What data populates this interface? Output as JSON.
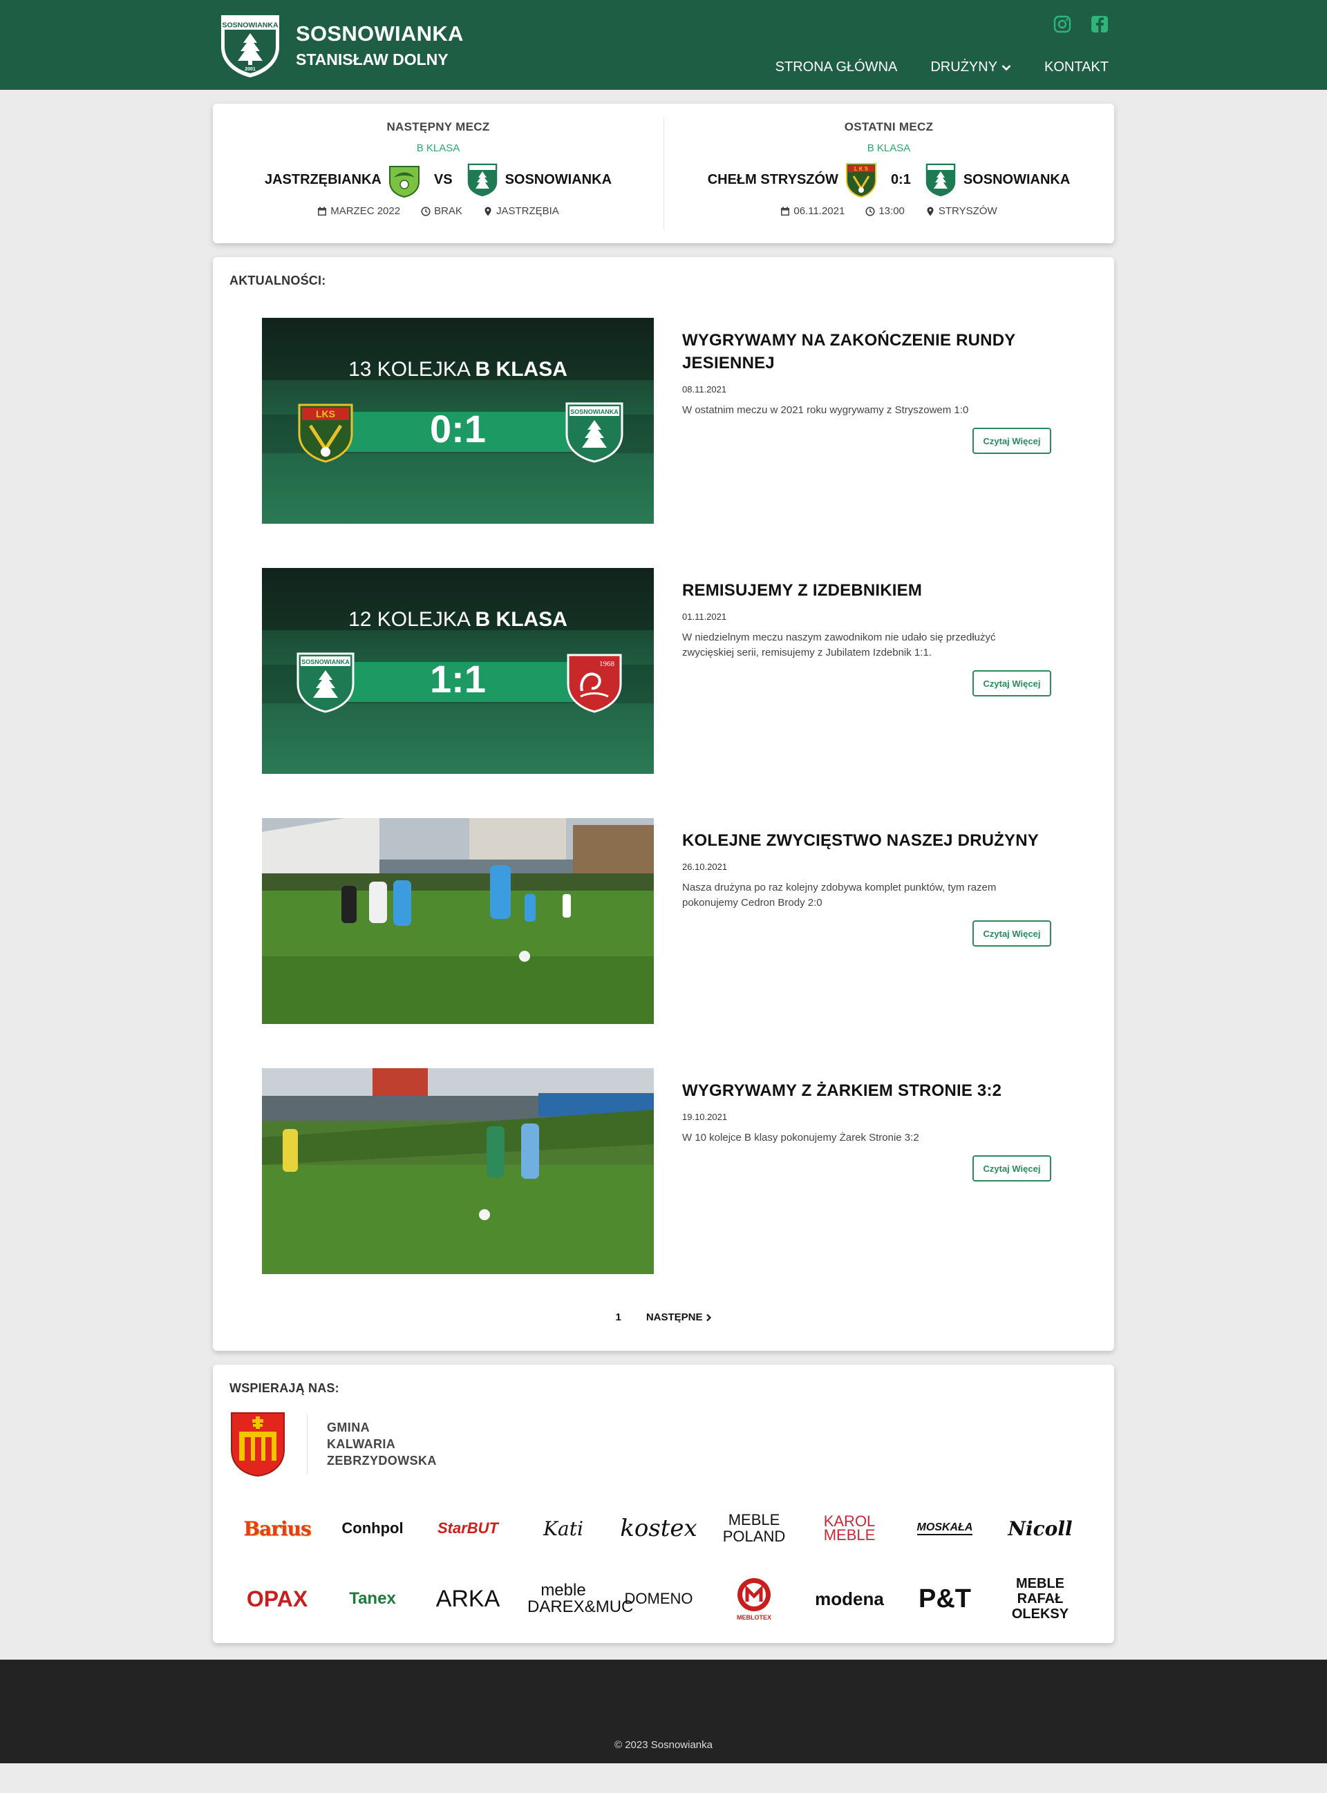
{
  "header": {
    "logo_text": "SOSNOWIANKA",
    "logo_year": "2001",
    "title": "SOSNOWIANKA",
    "subtitle": "STANISŁAW DOLNY",
    "social": [
      "instagram-icon",
      "facebook-icon"
    ],
    "nav": [
      {
        "label": "STRONA GŁÓWNA"
      },
      {
        "label": "DRUŻYNY"
      },
      {
        "label": "KONTAKT"
      }
    ],
    "colors": {
      "primary": "#1e5e44",
      "accent": "#2aa86a"
    }
  },
  "next_match": {
    "heading": "NASTĘPNY MECZ",
    "league": "B KLASA",
    "home": "JASTRZĘBIANKA",
    "separator": "VS",
    "away": "SOSNOWIANKA",
    "date": "MARZEC 2022",
    "time": "BRAK",
    "place": "JASTRZĘBIA"
  },
  "last_match": {
    "heading": "OSTATNI MECZ",
    "league": "B KLASA",
    "home": "CHEŁM STRYSZÓW",
    "score": "0:1",
    "away": "SOSNOWIANKA",
    "date": "06.11.2021",
    "time": "13:00",
    "place": "STRYSZÓW"
  },
  "news": {
    "heading": "AKTUALNOŚCI:",
    "read_more": "Czytaj Więcej",
    "items": [
      {
        "title": "WYGRYWAMY NA ZAKOŃCZENIE RUNDY JESIENNEJ",
        "date": "08.11.2021",
        "excerpt": "W ostatnim meczu w 2021 roku wygrywamy z Stryszowem 1:0",
        "graphic": {
          "round": "13 KOLEJKA",
          "league": "B KLASA",
          "score": "0:1",
          "left_crest": "LKS",
          "right_crest": "SOSNOWIANKA"
        }
      },
      {
        "title": "REMISUJEMY Z IZDEBNIKIEM",
        "date": "01.11.2021",
        "excerpt": "W niedzielnym meczu naszym zawodnikom nie udało się przedłużyć zwycięskiej serii, remisujemy z Jubilatem Izdebnik 1:1.",
        "graphic": {
          "round": "12 KOLEJKA",
          "league": "B KLASA",
          "score": "1:1",
          "left_crest": "SOSNOWIANKA",
          "right_crest": "1968"
        }
      },
      {
        "title": "KOLEJNE ZWYCIĘSTWO NASZEJ DRUŻYNY",
        "date": "26.10.2021",
        "excerpt": "Nasza drużyna po raz kolejny zdobywa komplet punktów, tym razem pokonujemy Cedron Brody 2:0"
      },
      {
        "title": "WYGRYWAMY Z ŻARKIEM STRONIE 3:2",
        "date": "19.10.2021",
        "excerpt": "W 10 kolejce B klasy pokonujemy Żarek Stronie 3:2"
      }
    ],
    "pagination": {
      "current": "1",
      "next": "NASTĘPNE"
    }
  },
  "sponsors": {
    "heading": "WSPIERAJĄ NAS:",
    "gmina": [
      "GMINA",
      "KALWARIA",
      "ZEBRZYDOWSKA"
    ],
    "logos": [
      {
        "text": "Barius",
        "color": "#e2401c"
      },
      {
        "text": "Conhpol",
        "color": "#111111"
      },
      {
        "text": "StarBUT",
        "color": "#d21c1c"
      },
      {
        "text": "Kati",
        "color": "#111111"
      },
      {
        "text": "kostex",
        "color": "#111111"
      },
      {
        "text": "MEBLE POLAND",
        "color": "#111111"
      },
      {
        "text": "KAROL MEBLE",
        "color": "#c8283c"
      },
      {
        "text": "MOSKAŁA",
        "color": "#111111"
      },
      {
        "text": "Nicoll",
        "color": "#111111"
      },
      {
        "text": "OPAX",
        "color": "#c81e1e"
      },
      {
        "text": "Tanex",
        "color": "#1e7a3e"
      },
      {
        "text": "ARKA",
        "color": "#111111"
      },
      {
        "text": "meble DAREX&MUC",
        "color": "#111111"
      },
      {
        "text": "DOMENO",
        "color": "#111111"
      },
      {
        "text": "MEBLOTEX",
        "color": "#c81e1e"
      },
      {
        "text": "modena",
        "color": "#111111"
      },
      {
        "text": "P&T",
        "color": "#111111"
      },
      {
        "text": "MEBLE RAFAŁ OLEKSY",
        "color": "#111111"
      }
    ]
  },
  "footer": {
    "text": "© 2023 Sosnowianka"
  }
}
